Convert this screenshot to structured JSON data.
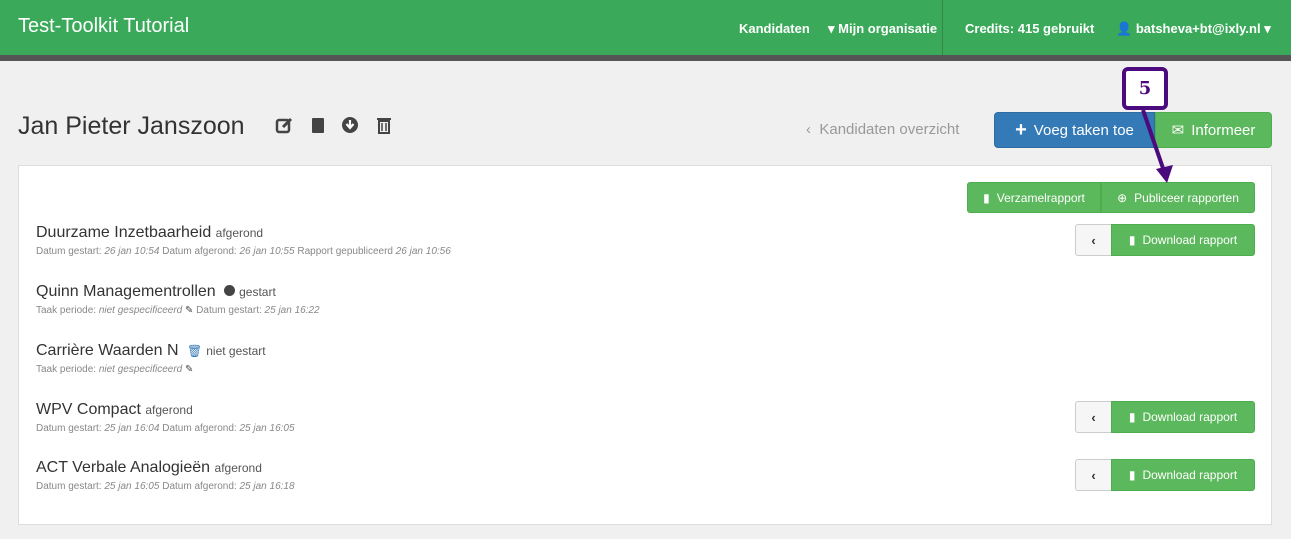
{
  "navbar": {
    "brand": "Test-Toolkit Tutorial",
    "kandidaten": "Kandidaten",
    "organisatie": "Mijn organisatie",
    "credits": "Credits: 415 gebruikt",
    "user": "batsheva+bt@ixly.nl",
    "color": "#3aaa5a"
  },
  "header": {
    "title": "Jan Pieter Janszoon",
    "back": "Kandidaten overzicht",
    "add_tasks": "Voeg taken toe",
    "inform": "Informeer"
  },
  "panel": {
    "verzamel": "Verzamelrapport",
    "publiceer": "Publiceer rapporten"
  },
  "tasks": [
    {
      "name": "Duurzame Inzetbaarheid",
      "status": "afgerond",
      "details": [
        [
          "Datum gestart:",
          "26 jan 10:54"
        ],
        [
          "Datum afgerond:",
          "26 jan 10:55"
        ],
        [
          "Rapport gepubliceerd",
          "26 jan 10:56"
        ]
      ],
      "download": "Download rapport"
    },
    {
      "name": "Quinn Managementrollen",
      "status": "gestart",
      "status_icon": "circle-x-icon",
      "details": [
        [
          "Taak periode:",
          "niet gespecificeerd"
        ],
        [
          "Datum gestart:",
          "25 jan 16:22"
        ]
      ]
    },
    {
      "name": "Carrière Waarden N",
      "status": "niet gestart",
      "status_icon": "trash-icon",
      "details": [
        [
          "Taak periode:",
          "niet gespecificeerd"
        ]
      ]
    },
    {
      "name": "WPV Compact",
      "status": "afgerond",
      "details": [
        [
          "Datum gestart:",
          "25 jan 16:04"
        ],
        [
          "Datum afgerond:",
          "25 jan 16:05"
        ]
      ],
      "download": "Download rapport"
    },
    {
      "name": "ACT Verbale Analogieën",
      "status": "afgerond",
      "details": [
        [
          "Datum gestart:",
          "25 jan 16:05"
        ],
        [
          "Datum afgerond:",
          "25 jan 16:18"
        ]
      ],
      "download": "Download rapport"
    }
  ],
  "callout": {
    "number": "5",
    "color": "#4b0a7e"
  }
}
